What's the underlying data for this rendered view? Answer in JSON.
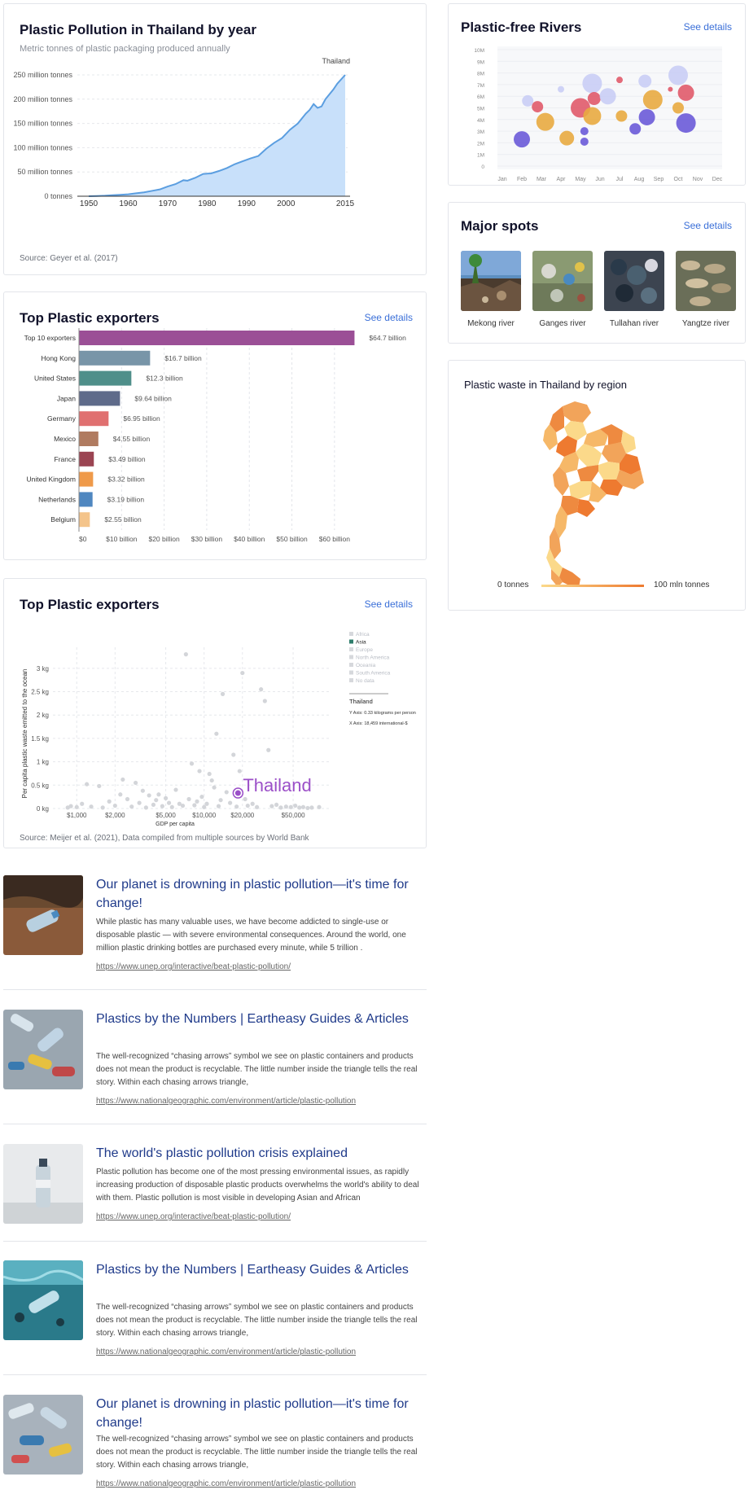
{
  "area_chart": {
    "title": "Plastic Pollution in Thailand by year",
    "subtitle": "Metric tonnes of plastic packaging produced annually",
    "source": "Source: Geyer et al. (2017)",
    "series_label": "Thailand",
    "fill_color": "#c8e0fa",
    "line_color": "#5b9ee0",
    "chart_data": {
      "type": "area",
      "x": [
        1950,
        1952,
        1954,
        1956,
        1958,
        1960,
        1962,
        1964,
        1966,
        1968,
        1970,
        1972,
        1974,
        1975,
        1977,
        1979,
        1981,
        1983,
        1985,
        1987,
        1989,
        1991,
        1993,
        1995,
        1997,
        1999,
        2001,
        2003,
        2005,
        2006,
        2007,
        2008,
        2009,
        2010,
        2012,
        2013,
        2015
      ],
      "values": [
        0,
        0.5,
        1,
        2,
        3,
        4,
        6,
        8,
        11,
        14,
        20,
        25,
        33,
        32,
        38,
        46,
        47,
        52,
        58,
        66,
        72,
        78,
        83,
        98,
        110,
        120,
        137,
        150,
        170,
        178,
        190,
        182,
        185,
        200,
        220,
        232,
        250
      ],
      "title": "Plastic Pollution in Thailand by year",
      "ylim": [
        0,
        260
      ],
      "yticks": [
        "0 tonnes",
        "50 million tonnes",
        "100 million tonnes",
        "150 million tonnes",
        "200 million tonnes",
        "250 million tonnes"
      ],
      "ytick_values": [
        0,
        50,
        100,
        150,
        200,
        250
      ],
      "xticks": [
        1950,
        1960,
        1970,
        1980,
        1990,
        2000,
        2015
      ]
    }
  },
  "bar_chart": {
    "title": "Top Plastic exporters",
    "see_details": "See details",
    "chart_data": {
      "type": "bar",
      "categories": [
        "Top 10 exporters",
        "Hong Kong",
        "United States",
        "Japan",
        "Germany",
        "Mexico",
        "France",
        "United Kingdom",
        "Netherlands",
        "Belgium"
      ],
      "values": [
        64.7,
        16.7,
        12.3,
        9.64,
        6.95,
        4.55,
        3.49,
        3.32,
        3.19,
        2.55
      ],
      "labels": [
        "$64.7 billion",
        "$16.7 billion",
        "$12.3 billion",
        "$9.64 billion",
        "$6.95 billion",
        "$4.55 billion",
        "$3.49 billion",
        "$3.32 billion",
        "$3.19 billion",
        "$2.55 billion"
      ],
      "colors": [
        "#9b4f96",
        "#7895a8",
        "#4f8f8a",
        "#5f6b8a",
        "#e07070",
        "#b07b60",
        "#9b4452",
        "#ef9a4a",
        "#4f87c0",
        "#f4c48a"
      ],
      "xlim": [
        0,
        65
      ],
      "xticks": [
        "$0",
        "$10 billion",
        "$20 billion",
        "$30 billion",
        "$40 billion",
        "$50 billion",
        "$60 billion"
      ],
      "xtick_values": [
        0,
        10,
        20,
        30,
        40,
        50,
        60
      ]
    }
  },
  "scatter_chart": {
    "title": "Top Plastic exporters",
    "see_details": "See details",
    "source": "Source: Meijer et al. (2021), Data compiled from multiple sources by World Bank",
    "ylabel": "Per capita plastic waste emitted to the ocean",
    "xlabel": "GDP per capita",
    "highlight_label": "Thailand",
    "highlight_color": "#9b4fc8",
    "legend": [
      "Africa",
      "Asia",
      "Europe",
      "North America",
      "Oceania",
      "South America",
      "No data"
    ],
    "legend_active": "Asia",
    "legend_active_color": "#2e7d6b",
    "info_country": "Thailand",
    "info_y": "Y Axis: 0.33 kilograms per person",
    "info_x": "X Axis: 18,459 international-$",
    "chart_data": {
      "type": "scatter",
      "xticks": [
        "$1,000",
        "$2,000",
        "$5,000",
        "$10,000",
        "$20,000",
        "$50,000"
      ],
      "xtick_values": [
        1000,
        2000,
        5000,
        10000,
        20000,
        50000
      ],
      "yticks": [
        "0 kg",
        "0.5 kg",
        "1 kg",
        "1.5 kg",
        "2 kg",
        "2.5 kg",
        "3 kg"
      ],
      "ytick_values": [
        0,
        0.5,
        1,
        1.5,
        2,
        2.5,
        3
      ],
      "ylim": [
        0,
        3.3
      ],
      "highlight": {
        "x": 18459,
        "y": 0.33
      },
      "points": [
        [
          850,
          0.02
        ],
        [
          900,
          0.05
        ],
        [
          1000,
          0.03
        ],
        [
          1100,
          0.1
        ],
        [
          1200,
          0.52
        ],
        [
          1300,
          0.04
        ],
        [
          1500,
          0.48
        ],
        [
          1600,
          0.02
        ],
        [
          1800,
          0.15
        ],
        [
          2000,
          0.06
        ],
        [
          2200,
          0.3
        ],
        [
          2300,
          0.62
        ],
        [
          2500,
          0.2
        ],
        [
          2700,
          0.04
        ],
        [
          2900,
          0.55
        ],
        [
          3100,
          0.12
        ],
        [
          3300,
          0.38
        ],
        [
          3500,
          0.02
        ],
        [
          3700,
          0.28
        ],
        [
          4000,
          0.08
        ],
        [
          4200,
          0.18
        ],
        [
          4400,
          0.3
        ],
        [
          4700,
          0.05
        ],
        [
          5000,
          0.22
        ],
        [
          5300,
          0.12
        ],
        [
          5600,
          0.03
        ],
        [
          6000,
          0.4
        ],
        [
          6400,
          0.1
        ],
        [
          6800,
          0.06
        ],
        [
          7200,
          3.3
        ],
        [
          7600,
          0.2
        ],
        [
          8000,
          0.96
        ],
        [
          8400,
          0.07
        ],
        [
          8800,
          0.15
        ],
        [
          9200,
          0.8
        ],
        [
          9600,
          0.25
        ],
        [
          10000,
          0.03
        ],
        [
          10500,
          0.1
        ],
        [
          11000,
          0.74
        ],
        [
          11500,
          0.6
        ],
        [
          12000,
          0.45
        ],
        [
          12500,
          1.6
        ],
        [
          13000,
          0.05
        ],
        [
          13500,
          0.18
        ],
        [
          14000,
          2.45
        ],
        [
          15000,
          0.35
        ],
        [
          16000,
          0.12
        ],
        [
          17000,
          1.15
        ],
        [
          18000,
          0.04
        ],
        [
          19000,
          0.8
        ],
        [
          20000,
          2.9
        ],
        [
          21000,
          0.2
        ],
        [
          22000,
          0.06
        ],
        [
          24000,
          0.1
        ],
        [
          26000,
          0.03
        ],
        [
          28000,
          2.55
        ],
        [
          30000,
          2.3
        ],
        [
          32000,
          1.25
        ],
        [
          34000,
          0.05
        ],
        [
          37000,
          0.08
        ],
        [
          40000,
          0.02
        ],
        [
          44000,
          0.04
        ],
        [
          48000,
          0.03
        ],
        [
          52000,
          0.06
        ],
        [
          56000,
          0.02
        ],
        [
          60000,
          0.03
        ],
        [
          65000,
          0.01
        ],
        [
          70000,
          0.02
        ],
        [
          80000,
          0.03
        ]
      ]
    }
  },
  "rivers": {
    "title": "Plastic-free Rivers",
    "see_details": "See details",
    "chart_data": {
      "type": "scatter",
      "categories": [
        "Jan",
        "Feb",
        "Mar",
        "Apr",
        "May",
        "Jun",
        "Jul",
        "Aug",
        "Sep",
        "Oct",
        "Nov",
        "Dec"
      ],
      "yticks": [
        "0",
        "1M",
        "2M",
        "3M",
        "4M",
        "5M",
        "6M",
        "7M",
        "8M",
        "9M",
        "10M"
      ],
      "ylim": [
        0,
        10
      ],
      "bubbles": [
        {
          "m": 1,
          "y": 2.3,
          "r": 10,
          "c": "#6a5ad8"
        },
        {
          "m": 1.3,
          "y": 5.6,
          "r": 7,
          "c": "#c9cdf5"
        },
        {
          "m": 1.8,
          "y": 5.1,
          "r": 7,
          "c": "#e05a6a"
        },
        {
          "m": 2.2,
          "y": 3.8,
          "r": 11,
          "c": "#e8aa40"
        },
        {
          "m": 3,
          "y": 6.6,
          "r": 4,
          "c": "#c9cdf5"
        },
        {
          "m": 3.3,
          "y": 2.4,
          "r": 9,
          "c": "#e8aa40"
        },
        {
          "m": 4,
          "y": 5,
          "r": 12,
          "c": "#e05a6a"
        },
        {
          "m": 4.2,
          "y": 3,
          "r": 5,
          "c": "#6a5ad8"
        },
        {
          "m": 4.2,
          "y": 2.1,
          "r": 5,
          "c": "#6a5ad8"
        },
        {
          "m": 4.6,
          "y": 7.1,
          "r": 12,
          "c": "#c9cdf5"
        },
        {
          "m": 4.6,
          "y": 4.3,
          "r": 11,
          "c": "#e8aa40"
        },
        {
          "m": 4.7,
          "y": 5.8,
          "r": 8,
          "c": "#e05a6a"
        },
        {
          "m": 5.4,
          "y": 6,
          "r": 10,
          "c": "#c9cdf5"
        },
        {
          "m": 6,
          "y": 7.4,
          "r": 4,
          "c": "#e05a6a"
        },
        {
          "m": 6.1,
          "y": 4.3,
          "r": 7,
          "c": "#e8aa40"
        },
        {
          "m": 6.8,
          "y": 3.2,
          "r": 7,
          "c": "#6a5ad8"
        },
        {
          "m": 7.3,
          "y": 7.3,
          "r": 8,
          "c": "#c9cdf5"
        },
        {
          "m": 7.4,
          "y": 4.2,
          "r": 10,
          "c": "#6a5ad8"
        },
        {
          "m": 7.7,
          "y": 5.7,
          "r": 12,
          "c": "#e8aa40"
        },
        {
          "m": 8.6,
          "y": 6.6,
          "r": 3,
          "c": "#e05a6a"
        },
        {
          "m": 9,
          "y": 7.8,
          "r": 12,
          "c": "#c9cdf5"
        },
        {
          "m": 9,
          "y": 5,
          "r": 7,
          "c": "#e8aa40"
        },
        {
          "m": 9.4,
          "y": 6.3,
          "r": 10,
          "c": "#e05a6a"
        },
        {
          "m": 9.4,
          "y": 3.7,
          "r": 12,
          "c": "#6a5ad8"
        }
      ]
    }
  },
  "spots": {
    "title": "Major spots",
    "see_details": "See details",
    "items": [
      {
        "label": "Mekong river"
      },
      {
        "label": "Ganges river"
      },
      {
        "label": "Tullahan river"
      },
      {
        "label": "Yangtze river"
      }
    ]
  },
  "map": {
    "title": "Plastic waste in Thailand by region",
    "legend_min": "0 tonnes",
    "legend_max": "100 mln tonnes",
    "color_low": "#fbd98a",
    "color_high": "#ee7a30"
  },
  "articles": [
    {
      "title": "Our planet is drowning in plastic pollution—it's time for change!",
      "text": "While plastic has many valuable uses, we have become addicted to single-use or disposable plastic — with severe environmental consequences. Around the world, one million plastic drinking bottles are purchased every minute, while 5 trillion .",
      "link": "https://www.unep.org/interactive/beat-plastic-pollution/"
    },
    {
      "title": "Plastics by the Numbers | Eartheasy Guides & Articles",
      "text": "The well-recognized “chasing arrows” symbol we see on plastic containers and products does not mean the product is recyclable. The little number inside the triangle tells the real story. Within each chasing arrows triangle,",
      "link": "https://www.nationalgeographic.com/environment/article/plastic-pollution"
    },
    {
      "title": "The world's plastic pollution crisis explained",
      "text": "Plastic pollution has become one of the most pressing environmental issues, as rapidly increasing production of disposable plastic products overwhelms the world's ability to deal with them. Plastic pollution is most visible in developing Asian and African",
      "link": "https://www.unep.org/interactive/beat-plastic-pollution/"
    },
    {
      "title": "Plastics by the Numbers | Eartheasy Guides & Articles",
      "text": "The well-recognized “chasing arrows” symbol we see on plastic containers and products does not mean the product is recyclable. The little number inside the triangle tells the real story. Within each chasing arrows triangle,",
      "link": "https://www.nationalgeographic.com/environment/article/plastic-pollution"
    },
    {
      "title": "Our planet is drowning in plastic pollution—it's time for change!",
      "text": "The well-recognized “chasing arrows” symbol we see on plastic containers and products does not mean the product is recyclable. The little number inside the triangle tells the real story. Within each chasing arrows triangle,",
      "link": "https://www.nationalgeographic.com/environment/article/plastic-pollution"
    }
  ]
}
